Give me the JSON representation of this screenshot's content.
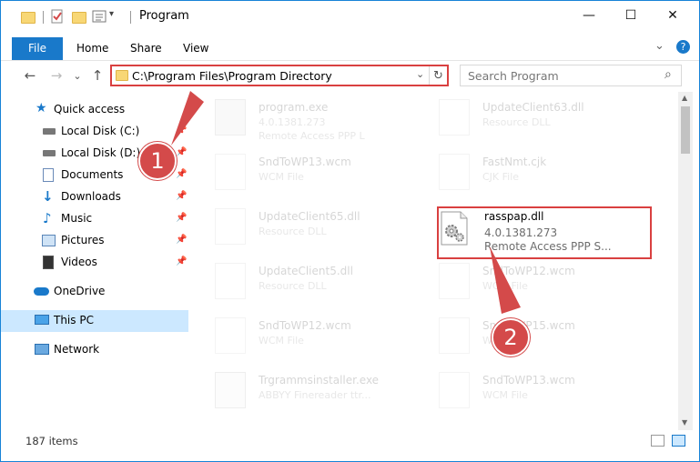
{
  "window": {
    "title": "Program",
    "controls": {
      "minimize": "—",
      "maximize": "☐",
      "close": "✕"
    }
  },
  "ribbon": {
    "tabs": [
      "File",
      "Home",
      "Share",
      "View"
    ],
    "collapse_glyph": "⌄",
    "help_glyph": "?"
  },
  "nav": {
    "back": "←",
    "forward": "→",
    "recent": "⌄",
    "up": "↑",
    "address": "C:\\Program Files\\Program Directory",
    "dropdown": "⌄",
    "refresh": "↻",
    "search_placeholder": "Search Program",
    "search_glyph": "⌕"
  },
  "sidebar": {
    "items": [
      {
        "label": "Quick access",
        "icon": "star-icon",
        "pinned": false
      },
      {
        "label": "Local Disk (C:)",
        "icon": "drive-icon",
        "pinned": true
      },
      {
        "label": "Local Disk (D:)",
        "icon": "drive-icon",
        "pinned": true
      },
      {
        "label": "Documents",
        "icon": "documents-icon",
        "pinned": true
      },
      {
        "label": "Downloads",
        "icon": "downloads-icon",
        "pinned": true
      },
      {
        "label": "Music",
        "icon": "music-icon",
        "pinned": true
      },
      {
        "label": "Pictures",
        "icon": "pictures-icon",
        "pinned": true
      },
      {
        "label": "Videos",
        "icon": "videos-icon",
        "pinned": true
      },
      {
        "label": "OneDrive",
        "icon": "cloud-icon",
        "pinned": false
      },
      {
        "label": "This PC",
        "icon": "pc-icon",
        "pinned": false,
        "selected": true
      },
      {
        "label": "Network",
        "icon": "network-icon",
        "pinned": false
      }
    ],
    "pin_glyph": "📌"
  },
  "files": [
    {
      "name": "program.exe",
      "line2": "4.0.1381.273",
      "line3": "Remote Access PPP L",
      "icon": "exe-icon",
      "faded": true
    },
    {
      "name": "UpdateClient63.dll",
      "line2": "Resource DLL",
      "line3": "",
      "icon": "gear-file-icon",
      "faded": true
    },
    {
      "name": "SndToWP13.wcm",
      "line2": "WCM File",
      "line3": "",
      "icon": "blank-file-icon",
      "faded": true
    },
    {
      "name": "FastNmt.cjk",
      "line2": "CJK File",
      "line3": "",
      "icon": "blank-file-icon",
      "faded": true
    },
    {
      "name": "UpdateClient65.dll",
      "line2": "Resource DLL",
      "line3": "",
      "icon": "gear-file-icon",
      "faded": true
    },
    {
      "name": "rasspap.dll",
      "line2": "4.0.1381.273",
      "line3": "Remote Access PPP S...",
      "icon": "gear-file-icon",
      "faded": false
    },
    {
      "name": "UpdateClient5.dll",
      "line2": "Resource DLL",
      "line3": "",
      "icon": "gear-file-icon",
      "faded": true
    },
    {
      "name": "SndToWP12.wcm",
      "line2": "WCM File",
      "line3": "",
      "icon": "blank-file-icon",
      "faded": true
    },
    {
      "name": "SndToWP12.wcm",
      "line2": "WCM File",
      "line3": "",
      "icon": "blank-file-icon",
      "faded": true
    },
    {
      "name": "SndToWP15.wcm",
      "line2": "WCM File",
      "line3": "",
      "icon": "blank-file-icon",
      "faded": true
    },
    {
      "name": "Trgrammsinstaller.exe",
      "line2": "ABBYY Finereader ttr...",
      "line3": "",
      "icon": "installer-icon",
      "faded": true
    },
    {
      "name": "SndToWP13.wcm",
      "line2": "WCM File",
      "line3": "",
      "icon": "blank-file-icon",
      "faded": true
    }
  ],
  "status": {
    "count": "187 items"
  },
  "callouts": [
    {
      "number": "1"
    },
    {
      "number": "2"
    }
  ],
  "colors": {
    "accent": "#1979ca",
    "highlight": "#d94040",
    "callout": "#d44a4a",
    "selected_nav": "#cce8ff"
  }
}
